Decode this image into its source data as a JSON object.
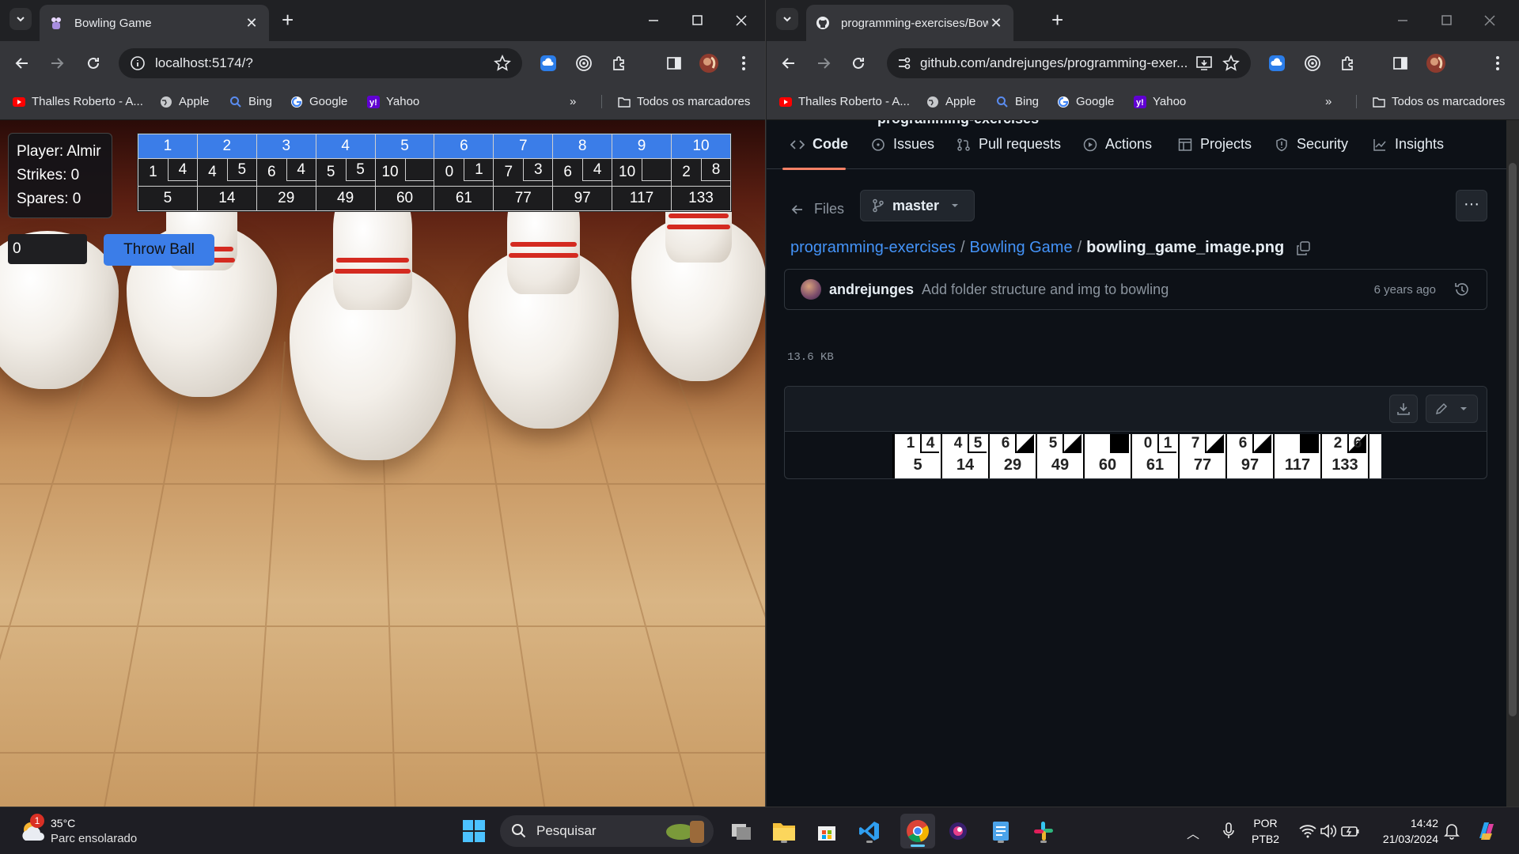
{
  "left": {
    "tab_title": "Bowling Game",
    "url": "localhost:5174/?",
    "bookmarks": [
      "Thalles Roberto - A...",
      "Apple",
      "Bing",
      "Google",
      "Yahoo"
    ],
    "all_bookmarks": "Todos os marcadores",
    "game": {
      "player": "Player: Almir",
      "strikes": "Strikes: 0",
      "spares": "Spares: 0",
      "roll_value": "0",
      "throw_label": "Throw Ball",
      "frames": [
        {
          "n": "1",
          "r1": "1",
          "r2": "4",
          "total": "5"
        },
        {
          "n": "2",
          "r1": "4",
          "r2": "5",
          "total": "14"
        },
        {
          "n": "3",
          "r1": "6",
          "r2": "4",
          "total": "29"
        },
        {
          "n": "4",
          "r1": "5",
          "r2": "5",
          "total": "49"
        },
        {
          "n": "5",
          "r1": "10",
          "r2": "",
          "total": "60"
        },
        {
          "n": "6",
          "r1": "0",
          "r2": "1",
          "total": "61"
        },
        {
          "n": "7",
          "r1": "7",
          "r2": "3",
          "total": "77"
        },
        {
          "n": "8",
          "r1": "6",
          "r2": "4",
          "total": "97"
        },
        {
          "n": "9",
          "r1": "10",
          "r2": "",
          "total": "117"
        },
        {
          "n": "10",
          "r1": "2",
          "r2": "8",
          "total": "133"
        }
      ]
    }
  },
  "right": {
    "tab_title": "programming-exercises/Bowlin",
    "url": "github.com/andrejunges/programming-exer...",
    "bookmarks": [
      "Thalles Roberto - A...",
      "Apple",
      "Bing",
      "Google",
      "Yahoo"
    ],
    "all_bookmarks": "Todos os marcadores",
    "repo_header": "programming-exercises",
    "nav": [
      "Code",
      "Issues",
      "Pull requests",
      "Actions",
      "Projects",
      "Security",
      "Insights"
    ],
    "files_label": "Files",
    "branch": "master",
    "crumbs": {
      "repo": "programming-exercises",
      "folder": "Bowling Game",
      "file": "bowling_game_image.png",
      "sep": "/"
    },
    "commit": {
      "author": "andrejunges",
      "message": "Add folder structure and img to bowling",
      "time": "6 years ago"
    },
    "file_size": "13.6 KB",
    "image_frames": [
      {
        "a": "1",
        "b": "4",
        "mark": "",
        "total": "5"
      },
      {
        "a": "4",
        "b": "5",
        "mark": "",
        "total": "14"
      },
      {
        "a": "6",
        "b": "",
        "mark": "spare",
        "total": "29"
      },
      {
        "a": "5",
        "b": "",
        "mark": "spare",
        "total": "49"
      },
      {
        "a": "",
        "b": "",
        "mark": "strike",
        "total": "60"
      },
      {
        "a": "0",
        "b": "1",
        "mark": "",
        "total": "61"
      },
      {
        "a": "7",
        "b": "",
        "mark": "spare",
        "total": "77"
      },
      {
        "a": "6",
        "b": "",
        "mark": "spare",
        "total": "97"
      },
      {
        "a": "",
        "b": "",
        "mark": "strike",
        "total": "117"
      },
      {
        "a": "2",
        "b": "6",
        "mark": "spare",
        "total": "133"
      }
    ]
  },
  "taskbar": {
    "weather_temp": "35°C",
    "weather_desc": "Parc ensolarado",
    "weather_badge": "1",
    "search_placeholder": "Pesquisar",
    "lang_top": "POR",
    "lang_bottom": "PTB2",
    "time": "14:42",
    "date": "21/03/2024"
  },
  "colors": {
    "accent_blue": "#3b7de8",
    "gh_link": "#4493f8",
    "gh_underline": "#f78166"
  }
}
